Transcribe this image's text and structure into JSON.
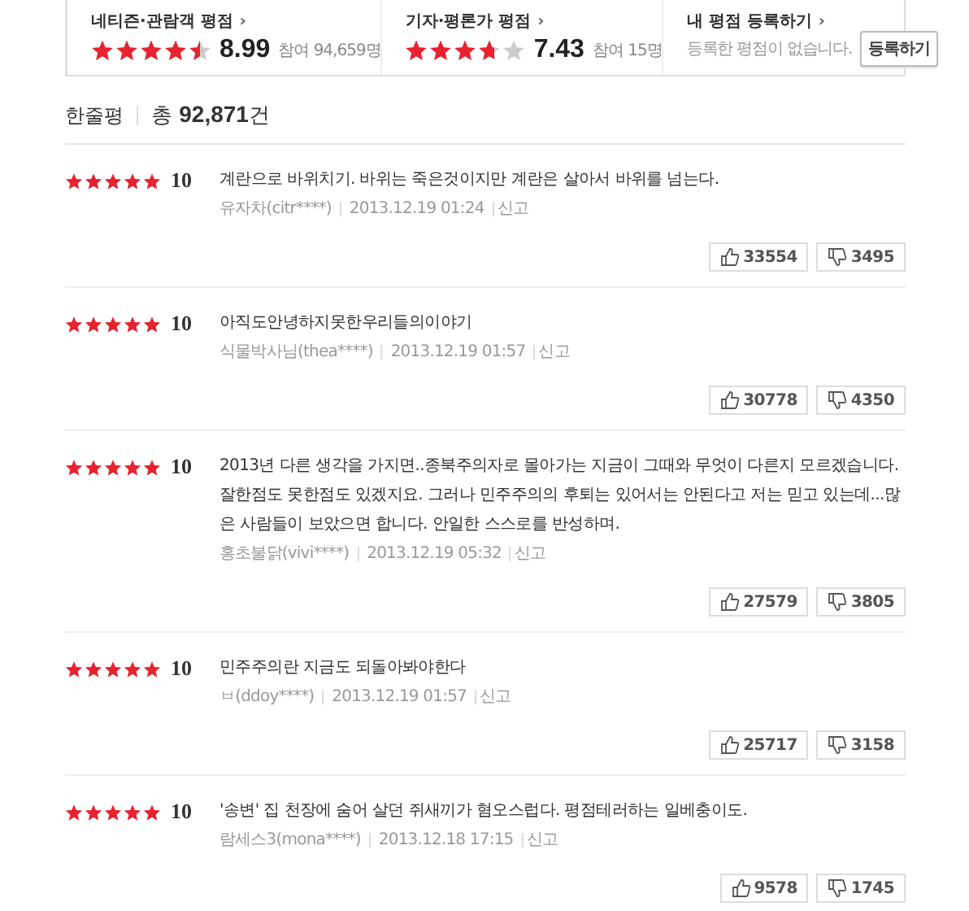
{
  "summary": [
    {
      "kind": "score",
      "title": "네티즌·관람객 평점",
      "arrow": "›",
      "stars": 4.5,
      "score": "8.99",
      "participants": "참여 94,659명"
    },
    {
      "kind": "score",
      "title": "기자·평론가 평점",
      "arrow": "›",
      "stars": 3.7,
      "score": "7.43",
      "participants": "참여 15명"
    },
    {
      "kind": "mine",
      "title": "내 평점 등록하기",
      "arrow": "›",
      "message": "등록한 평점이 없습니다.",
      "button": "등록하기"
    }
  ],
  "header": {
    "title": "한줄평",
    "total_prefix": "총",
    "total": "92,871",
    "total_suffix": "건"
  },
  "reviews": [
    {
      "stars": 5,
      "score": "10",
      "text": "계란으로 바위치기. 바위는 죽은것이지만 계란은 살아서 바위를 넘는다.",
      "author": "유자차(citr****)",
      "date": "2013.12.19 01:24",
      "report": "신고",
      "likes": "33554",
      "dislikes": "3495"
    },
    {
      "stars": 5,
      "score": "10",
      "text": "아직도안녕하지못한우리들의이야기",
      "author": "식물박사님(thea****)",
      "date": "2013.12.19 01:57",
      "report": "신고",
      "likes": "30778",
      "dislikes": "4350"
    },
    {
      "stars": 5,
      "score": "10",
      "text": "2013년 다른 생각을 가지면..종북주의자로 몰아가는 지금이 그때와 무엇이 다른지 모르겠습니다. 잘한점도 못한점도 있겠지요. 그러나 민주주의의 후퇴는 있어서는 안된다고 저는 믿고 있는데...많은 사람들이 보았으면 합니다. 안일한 스스로를 반성하며.",
      "author": "홍초불닭(vivi****)",
      "date": "2013.12.19 05:32",
      "report": "신고",
      "likes": "27579",
      "dislikes": "3805"
    },
    {
      "stars": 5,
      "score": "10",
      "text": "민주주의란 지금도 되돌아봐야한다",
      "author": "ㅂ(ddoy****)",
      "date": "2013.12.19 01:57",
      "report": "신고",
      "likes": "25717",
      "dislikes": "3158"
    },
    {
      "stars": 5,
      "score": "10",
      "text": "'송변' 집 천장에 숨어 살던 쥐새끼가 혐오스럽다. 평점테러하는 일베충이도.",
      "author": "람세스3(mona****)",
      "date": "2013.12.18 17:15",
      "report": "신고",
      "likes": "9578",
      "dislikes": "1745"
    }
  ]
}
